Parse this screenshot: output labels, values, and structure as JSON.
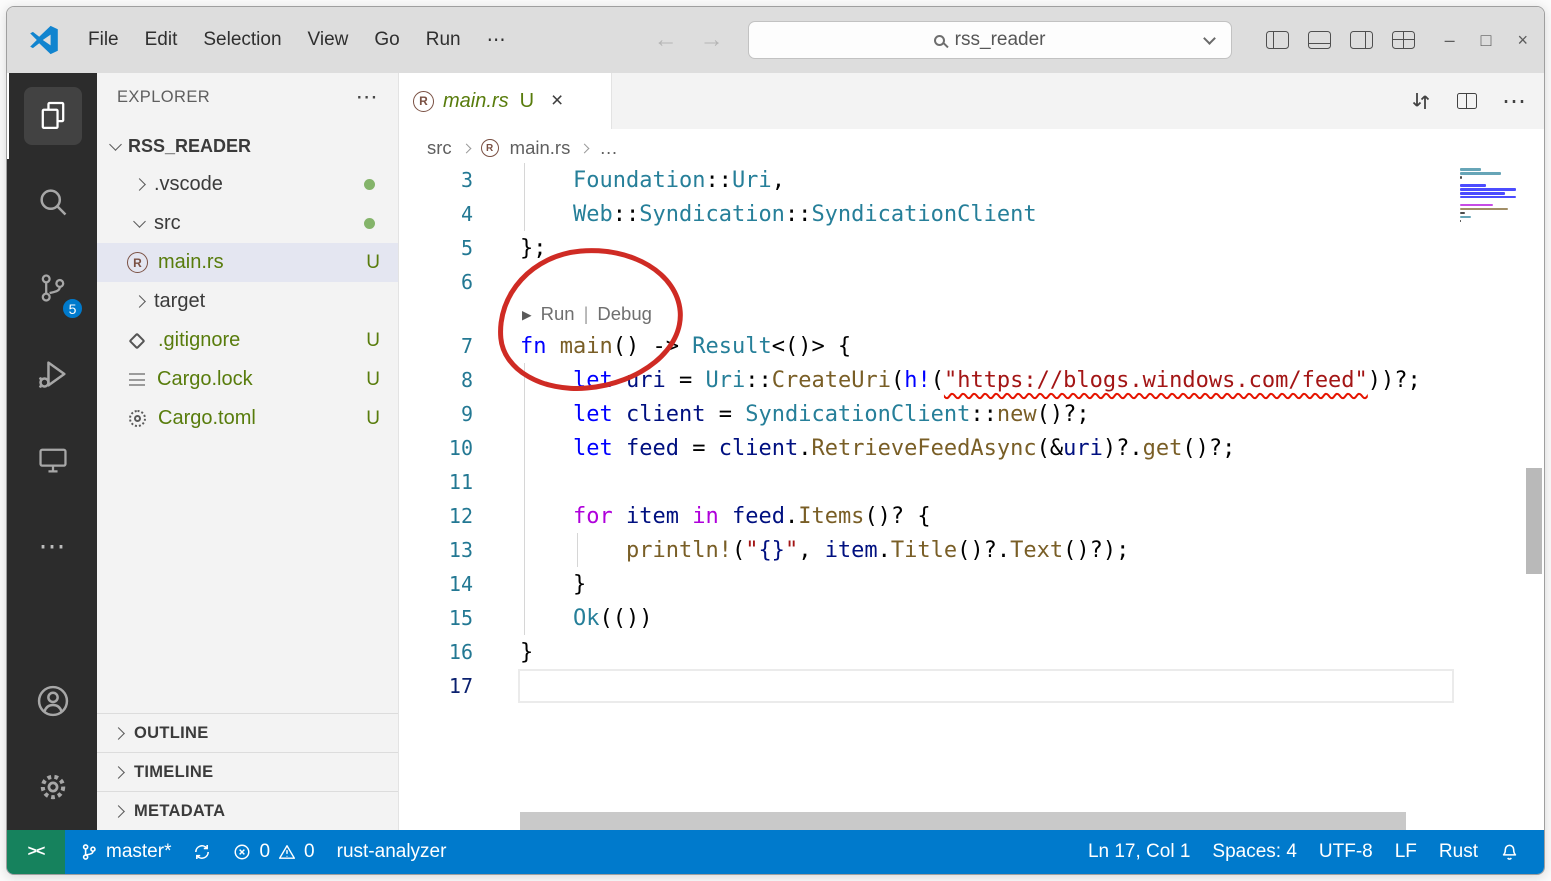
{
  "colors": {
    "accent": "#007acc",
    "statusbar_bg": "#007acc",
    "remote_bg": "#16825d",
    "titlebar_bg": "#dddddd",
    "activitybar_bg": "#2c2c2c",
    "sidebar_bg": "#f3f3f3",
    "selection_bg": "#e4e6f1",
    "untracked_green": "#587c0c",
    "annotation_red": "#cf2b24",
    "squiggle_red": "#e51400",
    "line_number": "#237893",
    "token": {
      "p": "#000000",
      "k": "#0000ff",
      "c": "#af00db",
      "t": "#267f99",
      "f": "#795e26",
      "v": "#001080",
      "s": "#a31515",
      "m": "#0000ff"
    }
  },
  "icons": {
    "back": "←",
    "forward": "→",
    "more": "⋯",
    "minimize": "–",
    "maximize": "□",
    "close": "×",
    "tab_close": "×",
    "rust_letter": "R"
  },
  "title_bar": {
    "menus": [
      "File",
      "Edit",
      "Selection",
      "View",
      "Go",
      "Run",
      "⋯"
    ],
    "search_value": "rss_reader"
  },
  "activity_bar": {
    "scm_badge": "5"
  },
  "sidebar": {
    "title": "EXPLORER",
    "root": "RSS_READER",
    "items": [
      {
        "label": ".vscode",
        "kind": "folder",
        "state": "collapsed",
        "dot": true
      },
      {
        "label": "src",
        "kind": "folder",
        "state": "expanded",
        "dot": true
      },
      {
        "label": "main.rs",
        "kind": "rust",
        "badge": "U",
        "selected": true
      },
      {
        "label": "target",
        "kind": "folder",
        "state": "collapsed"
      },
      {
        "label": ".gitignore",
        "kind": "git",
        "badge": "U"
      },
      {
        "label": "Cargo.lock",
        "kind": "doc",
        "badge": "U"
      },
      {
        "label": "Cargo.toml",
        "kind": "config",
        "badge": "U"
      }
    ],
    "sections": [
      "OUTLINE",
      "TIMELINE",
      "METADATA"
    ]
  },
  "editor": {
    "tab": {
      "label": "main.rs",
      "git_badge": "U"
    },
    "breadcrumbs": [
      "src",
      "main.rs",
      "…"
    ],
    "codelens": {
      "play": "▶",
      "run": "Run",
      "separator": "|",
      "debug": "Debug"
    },
    "cursor_line": 17,
    "code": [
      {
        "n": 3,
        "seg": [
          [
            "    ",
            "p"
          ],
          [
            "Foundation",
            "t"
          ],
          [
            "::",
            "p"
          ],
          [
            "Uri",
            "t"
          ],
          [
            ",",
            "p"
          ]
        ]
      },
      {
        "n": 4,
        "seg": [
          [
            "    ",
            "p"
          ],
          [
            "Web",
            "t"
          ],
          [
            "::",
            "p"
          ],
          [
            "Syndication",
            "t"
          ],
          [
            "::",
            "p"
          ],
          [
            "SyndicationClient",
            "t"
          ]
        ]
      },
      {
        "n": 5,
        "seg": [
          [
            "};",
            "p"
          ]
        ]
      },
      {
        "n": 6,
        "seg": []
      },
      {
        "lens": true
      },
      {
        "n": 7,
        "seg": [
          [
            "fn",
            "k"
          ],
          [
            " ",
            "p"
          ],
          [
            "main",
            "f"
          ],
          [
            "() -> ",
            "p"
          ],
          [
            "Result",
            "t"
          ],
          [
            "<()> {",
            "p"
          ]
        ]
      },
      {
        "n": 8,
        "seg": [
          [
            "    ",
            "p"
          ],
          [
            "let",
            "k"
          ],
          [
            " ",
            "p"
          ],
          [
            "uri",
            "v"
          ],
          [
            " = ",
            "p"
          ],
          [
            "Uri",
            "t"
          ],
          [
            "::",
            "p"
          ],
          [
            "CreateUri",
            "f"
          ],
          [
            "(",
            "p"
          ],
          [
            "h!",
            "m"
          ],
          [
            "(",
            "p"
          ],
          [
            "\"https://blogs.windows.com/feed\"",
            "e"
          ],
          [
            "))?;",
            "p"
          ]
        ]
      },
      {
        "n": 9,
        "seg": [
          [
            "    ",
            "p"
          ],
          [
            "let",
            "k"
          ],
          [
            " ",
            "p"
          ],
          [
            "client",
            "v"
          ],
          [
            " = ",
            "p"
          ],
          [
            "SyndicationClient",
            "t"
          ],
          [
            "::",
            "p"
          ],
          [
            "new",
            "f"
          ],
          [
            "()?;",
            "p"
          ]
        ]
      },
      {
        "n": 10,
        "seg": [
          [
            "    ",
            "p"
          ],
          [
            "let",
            "k"
          ],
          [
            " ",
            "p"
          ],
          [
            "feed",
            "v"
          ],
          [
            " = ",
            "p"
          ],
          [
            "client",
            "v"
          ],
          [
            ".",
            "p"
          ],
          [
            "RetrieveFeedAsync",
            "f"
          ],
          [
            "(&",
            "p"
          ],
          [
            "uri",
            "v"
          ],
          [
            ")?.",
            "p"
          ],
          [
            "get",
            "f"
          ],
          [
            "()?;",
            "p"
          ]
        ]
      },
      {
        "n": 11,
        "seg": []
      },
      {
        "n": 12,
        "seg": [
          [
            "    ",
            "p"
          ],
          [
            "for",
            "c"
          ],
          [
            " ",
            "p"
          ],
          [
            "item",
            "v"
          ],
          [
            " ",
            "p"
          ],
          [
            "in",
            "c"
          ],
          [
            " ",
            "p"
          ],
          [
            "feed",
            "v"
          ],
          [
            ".",
            "p"
          ],
          [
            "Items",
            "f"
          ],
          [
            "()? {",
            "p"
          ]
        ]
      },
      {
        "n": 13,
        "seg": [
          [
            "        ",
            "p"
          ],
          [
            "println!",
            "f"
          ],
          [
            "(",
            "p"
          ],
          [
            "\"",
            "s"
          ],
          [
            "{}",
            "v"
          ],
          [
            "\"",
            "s"
          ],
          [
            ", ",
            "p"
          ],
          [
            "item",
            "v"
          ],
          [
            ".",
            "p"
          ],
          [
            "Title",
            "f"
          ],
          [
            "()?.",
            "p"
          ],
          [
            "Text",
            "f"
          ],
          [
            "()?);",
            "p"
          ]
        ]
      },
      {
        "n": 14,
        "seg": [
          [
            "    }",
            "p"
          ]
        ]
      },
      {
        "n": 15,
        "seg": [
          [
            "    ",
            "p"
          ],
          [
            "Ok",
            "t"
          ],
          [
            "(())",
            "p"
          ]
        ]
      },
      {
        "n": 16,
        "seg": [
          [
            "}",
            "p"
          ]
        ]
      },
      {
        "n": 17,
        "seg": []
      }
    ]
  },
  "status_bar": {
    "remote_icon": "><",
    "branch": "master*",
    "errors": "0",
    "warnings": "0",
    "server": "rust-analyzer",
    "line_col": "Ln 17, Col 1",
    "indentation": "Spaces: 4",
    "encoding": "UTF-8",
    "eol": "LF",
    "language": "Rust"
  }
}
